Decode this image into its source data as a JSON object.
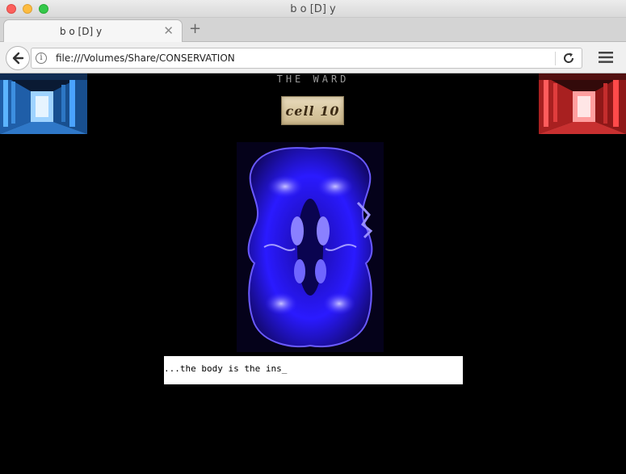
{
  "window": {
    "title": "b o [D] y"
  },
  "tabs": [
    {
      "label": "b o [D] y",
      "active": true
    }
  ],
  "tabbar": {
    "close_symbol": "✕",
    "new_tab_symbol": "+"
  },
  "toolbar": {
    "url": "file:///Volumes/Share/CONSERVATION",
    "info_symbol": "i"
  },
  "page": {
    "ward_title": "THE WARD",
    "cell_label": "cell 10",
    "typing_text": "...the body is the ins_"
  },
  "icons": {
    "back": "back-arrow-icon",
    "info": "info-icon",
    "reload": "reload-icon",
    "menu": "hamburger-menu-icon"
  },
  "colors": {
    "page_background": "#000000",
    "left_corridor_tint": "#4aa3ff",
    "right_corridor_tint": "#ff4a4a",
    "brain_scan_tint": "#2a1aff"
  }
}
